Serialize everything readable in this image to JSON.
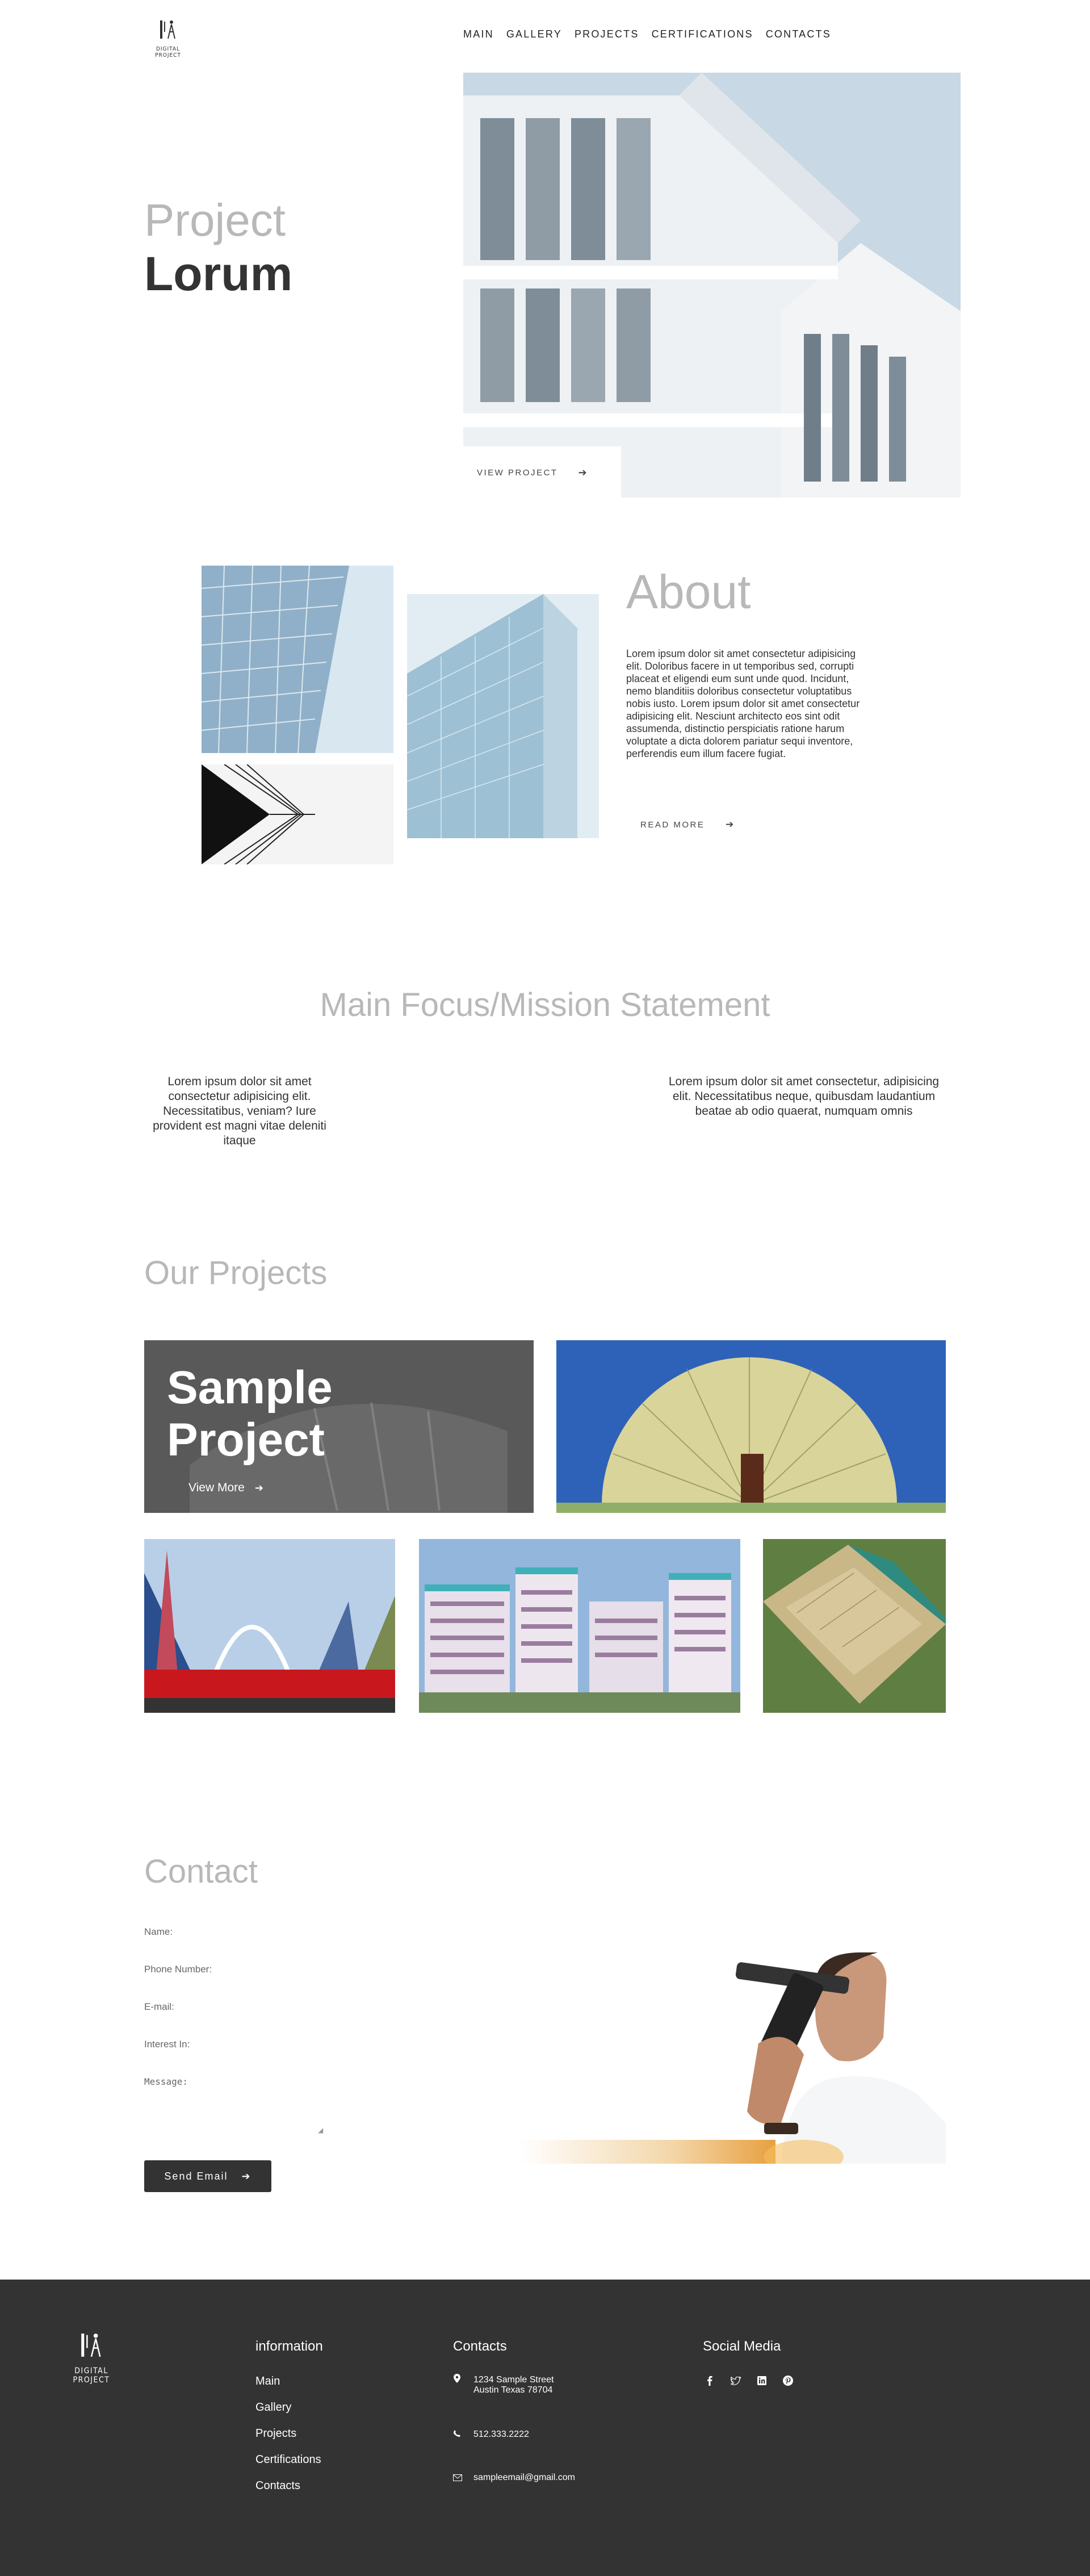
{
  "header": {
    "logo_text": "DIGITAL PROJECT",
    "nav": [
      "MAIN",
      "GALLERY",
      "PROJECTS",
      "CERTIFICATIONS",
      "CONTACTS"
    ]
  },
  "hero": {
    "title_light": "Project",
    "title_bold": "Lorum",
    "button_label": "VIEW PROJECT",
    "button_icon": "arrow-right-icon"
  },
  "about": {
    "title": "About",
    "text": "Lorem ipsum dolor sit amet consectetur adipisicing elit. Doloribus facere in ut temporibus sed, corrupti placeat et eligendi eum sunt unde quod. Incidunt, nemo blanditiis doloribus consectetur voluptatibus nobis iusto. Lorem ipsum dolor sit amet consectetur adipisicing elit. Nesciunt architecto eos sint odit assumenda, distinctio perspiciatis ratione harum voluptate a dicta dolorem pariatur sequi inventore, perferendis eum illum facere fugiat.",
    "button_label": "READ MORE"
  },
  "mission": {
    "title": "Main Focus/Mission Statement",
    "col1": "Lorem ipsum dolor sit amet consectetur adipisicing elit. Necessitatibus, veniam? Iure provident est magni vitae deleniti itaque",
    "col2": "Lorem ipsum dolor sit amet consectetur, adipisicing elit. Necessitatibus neque, quibusdam laudantium beatae ab odio quaerat, numquam omnis"
  },
  "projects": {
    "title": "Our Projects",
    "sample_title_line1": "Sample",
    "sample_title_line2": "Project",
    "view_more": "View More"
  },
  "contact": {
    "title": "Contact",
    "fields": {
      "name": "Name:",
      "phone": "Phone Number:",
      "email": "E-mail:",
      "interest": "Interest In:",
      "message": "Message:"
    },
    "button_label": "Send Email"
  },
  "footer": {
    "logo_text": "DIGITAL PROJECT",
    "info_heading": "information",
    "info_links": [
      "Main",
      "Gallery",
      "Projects",
      "Certifications",
      "Contacts"
    ],
    "contacts_heading": "Contacts",
    "address_line1": "1234 Sample Street",
    "address_line2": "Austin Texas 78704",
    "phone": "512.333.2222",
    "email": "sampleemail@gmail.com",
    "social_heading": "Social Media",
    "social_icons": [
      "facebook-icon",
      "twitter-icon",
      "linkedin-icon",
      "pinterest-icon"
    ]
  },
  "colors": {
    "footer_bg": "#333333",
    "heading_gray": "#b8b8b8",
    "dark_text": "#333333",
    "button_dark": "#333333"
  }
}
